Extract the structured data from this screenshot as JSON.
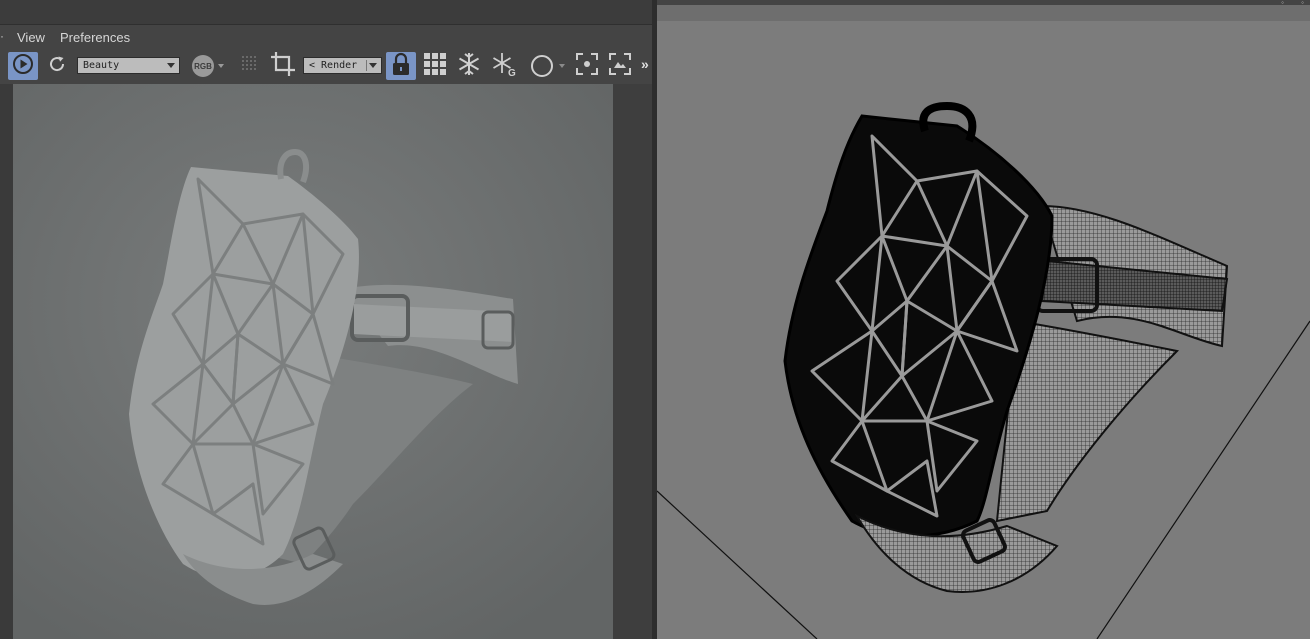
{
  "menu": {
    "view": "View",
    "preferences": "Preferences"
  },
  "toolbar": {
    "aov_value": "Beauty",
    "camera_value": "< Render",
    "rgb_label": "RGB",
    "overflow_label": "»"
  },
  "icons": {
    "play": "play-icon",
    "refresh": "refresh-icon",
    "rgb": "rgb-channel-icon",
    "grid_dots": "dots-grid-icon",
    "crop": "crop-icon",
    "lock": "lock-icon",
    "grid": "bucket-grid-icon",
    "snowflake": "freeze-icon",
    "snowflake_g": "freeze-geometry-icon",
    "circle": "circle-icon",
    "focus": "focus-icon",
    "region": "region-icon"
  },
  "colors": {
    "panel_bg": "#444444",
    "active_button": "#7a95c6",
    "render_bg": "#6c6f6f",
    "viewport_bg": "#7c7c7c"
  }
}
